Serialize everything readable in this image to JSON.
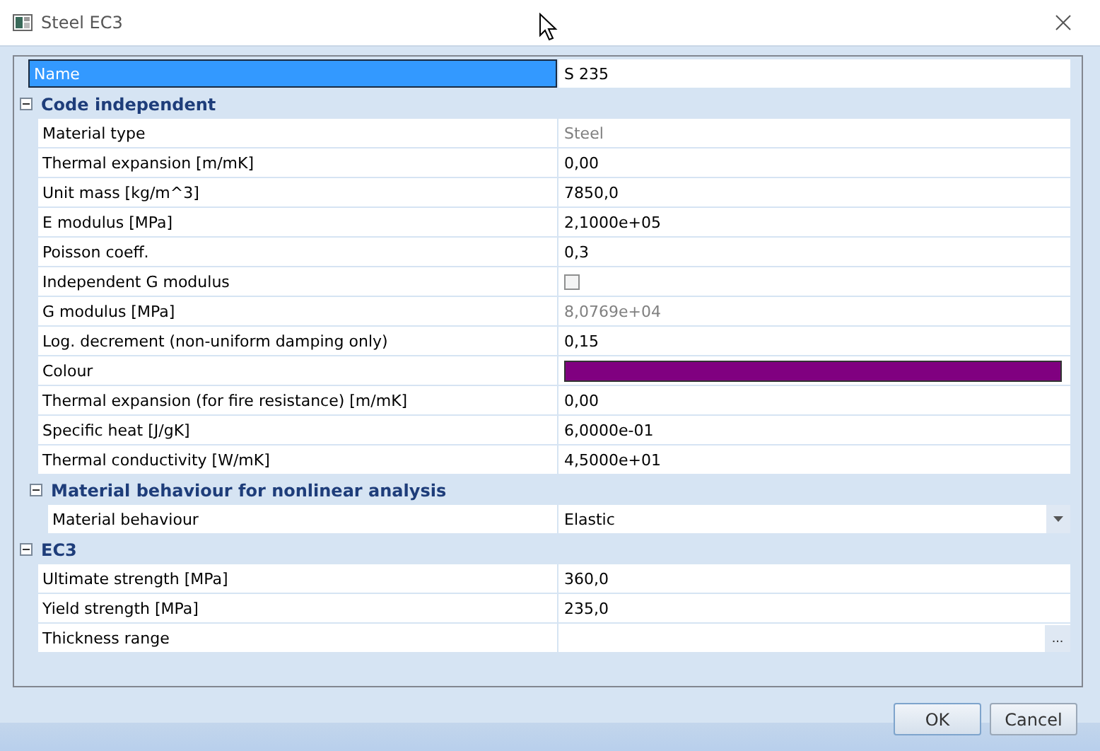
{
  "window": {
    "title": "Steel EC3"
  },
  "grid": {
    "items": [
      {
        "kind": "property",
        "label": "Name",
        "value": "S 235",
        "selected": true,
        "disabled": false
      },
      {
        "kind": "group",
        "label": "Code independent",
        "expanded": true,
        "children": [
          {
            "kind": "property",
            "label": "Material type",
            "value": "Steel",
            "selected": false,
            "disabled": true
          },
          {
            "kind": "property",
            "label": "Thermal expansion  [m/mK]",
            "value": "0,00",
            "selected": false,
            "disabled": false
          },
          {
            "kind": "property",
            "label": "Unit mass [kg/m^3]",
            "value": "7850,0",
            "selected": false,
            "disabled": false
          },
          {
            "kind": "property",
            "label": "E modulus [MPa]",
            "value": "2,1000e+05",
            "selected": false,
            "disabled": false
          },
          {
            "kind": "property",
            "label": "Poisson coeff.",
            "value": "0,3",
            "selected": false,
            "disabled": false
          },
          {
            "kind": "checkbox",
            "label": "Independent G modulus",
            "checked": false,
            "selected": false
          },
          {
            "kind": "property",
            "label": "G modulus [MPa]",
            "value": "8,0769e+04",
            "selected": false,
            "disabled": true
          },
          {
            "kind": "property",
            "label": "Log. decrement (non-uniform damping only)",
            "value": "0,15",
            "selected": false,
            "disabled": false
          },
          {
            "kind": "color",
            "label": "Colour",
            "color": "#800080",
            "selected": false
          },
          {
            "kind": "property",
            "label": "Thermal expansion (for fire resistance)  [m/mK]",
            "value": "0,00",
            "selected": false,
            "disabled": false
          },
          {
            "kind": "property",
            "label": "Specific heat [J/gK]",
            "value": "6,0000e-01",
            "selected": false,
            "disabled": false
          },
          {
            "kind": "property",
            "label": "Thermal conductivity [W/mK]",
            "value": "4,5000e+01",
            "selected": false,
            "disabled": false
          },
          {
            "kind": "group",
            "label": "Material behaviour for nonlinear analysis",
            "expanded": true,
            "children": [
              {
                "kind": "dropdown",
                "label": "Material behaviour",
                "value": "Elastic",
                "selected": false
              }
            ]
          }
        ]
      },
      {
        "kind": "group",
        "label": "EC3",
        "expanded": true,
        "children": [
          {
            "kind": "property",
            "label": "Ultimate strength [MPa]",
            "value": "360,0",
            "selected": false,
            "disabled": false
          },
          {
            "kind": "property",
            "label": "Yield strength [MPa]",
            "value": "235,0",
            "selected": false,
            "disabled": false
          },
          {
            "kind": "ellipsis",
            "label": "Thickness range",
            "button": "...",
            "selected": false
          }
        ]
      }
    ]
  },
  "buttons": [
    {
      "label": "OK",
      "default": true
    },
    {
      "label": "Cancel",
      "default": false
    }
  ]
}
